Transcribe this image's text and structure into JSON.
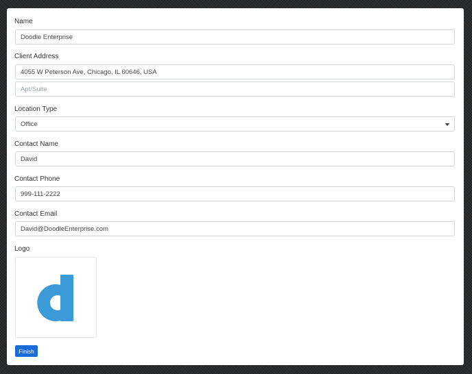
{
  "form": {
    "name": {
      "label": "Name",
      "value": "Doodle Enterprise"
    },
    "address": {
      "label": "Client Address",
      "value": "4055 W Peterson Ave, Chicago, IL 60646, USA",
      "apt_placeholder": "Apt/Suite"
    },
    "location_type": {
      "label": "Location Type",
      "value": "Office"
    },
    "contact_name": {
      "label": "Contact Name",
      "value": "David"
    },
    "contact_phone": {
      "label": "Contact Phone",
      "value": "999-111-2222"
    },
    "contact_email": {
      "label": "Contact Email",
      "value": "David@DoodleEnterprise.com"
    },
    "logo": {
      "label": "Logo",
      "letter": "d",
      "icon": "doodle-d-logo"
    }
  },
  "actions": {
    "finish_label": "Finish"
  },
  "colors": {
    "accent": "#1a6bd8",
    "logo_blue": "#3d9ad8",
    "background": "#2f3032"
  }
}
